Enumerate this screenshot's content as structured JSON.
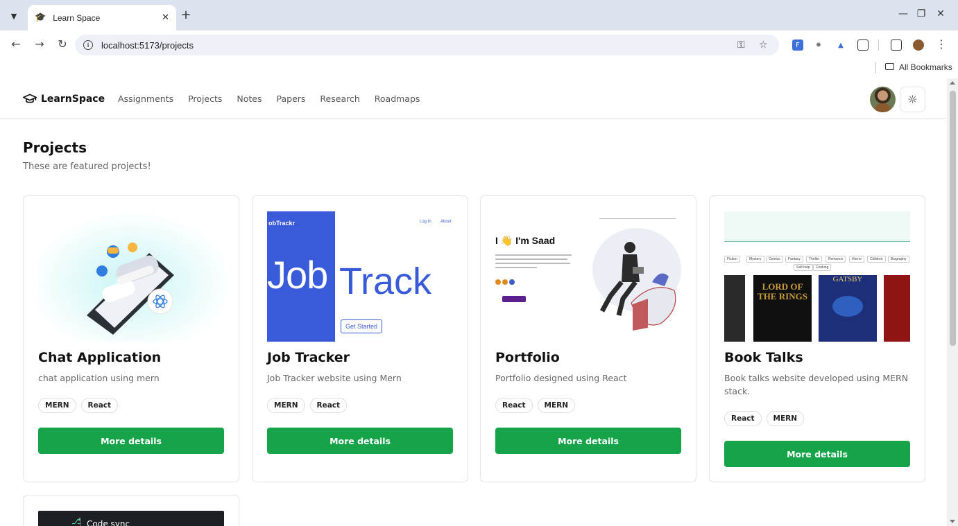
{
  "browser": {
    "tab_title": "Learn Space",
    "url": "localhost:5173/projects",
    "bookmarks_label": "All Bookmarks"
  },
  "header": {
    "brand": "LearnSpace",
    "nav": [
      "Assignments",
      "Projects",
      "Notes",
      "Papers",
      "Research",
      "Roadmaps"
    ]
  },
  "page": {
    "title": "Projects",
    "subtitle": "These are featured projects!"
  },
  "projects": [
    {
      "title": "Chat Application",
      "description": "chat application using mern",
      "tags": [
        "MERN",
        "React"
      ],
      "button": "More details"
    },
    {
      "title": "Job Tracker",
      "description": "Job Tracker website using Mern",
      "tags": [
        "MERN",
        "React"
      ],
      "button": "More details",
      "preview": {
        "logo": "obTrackr",
        "nav": [
          "Log In",
          "About"
        ],
        "word1": "Job",
        "word2": "Track",
        "cta": "Get Started"
      }
    },
    {
      "title": "Portfolio",
      "description": "Portfolio designed using React",
      "tags": [
        "React",
        "MERN"
      ],
      "button": "More details",
      "preview": {
        "greeting": "I 👋 I'm Saad"
      }
    },
    {
      "title": "Book Talks",
      "description": "Book talks website developed using MERN stack.",
      "tags": [
        "React",
        "MERN"
      ],
      "button": "More details",
      "preview": {
        "genres": [
          "Fiction",
          "Mystery",
          "Comics",
          "Fantasy",
          "Thriller",
          "Romance",
          "Horror",
          "Children",
          "Biography",
          "Self-help",
          "Cooking"
        ],
        "book_titles": [
          "LORD OF THE RINGS",
          "GATSBY"
        ]
      }
    }
  ],
  "partial_card": {
    "label": "Code sync"
  },
  "colors": {
    "primary_green": "#16a34a",
    "job_blue": "#3a5bd9"
  }
}
